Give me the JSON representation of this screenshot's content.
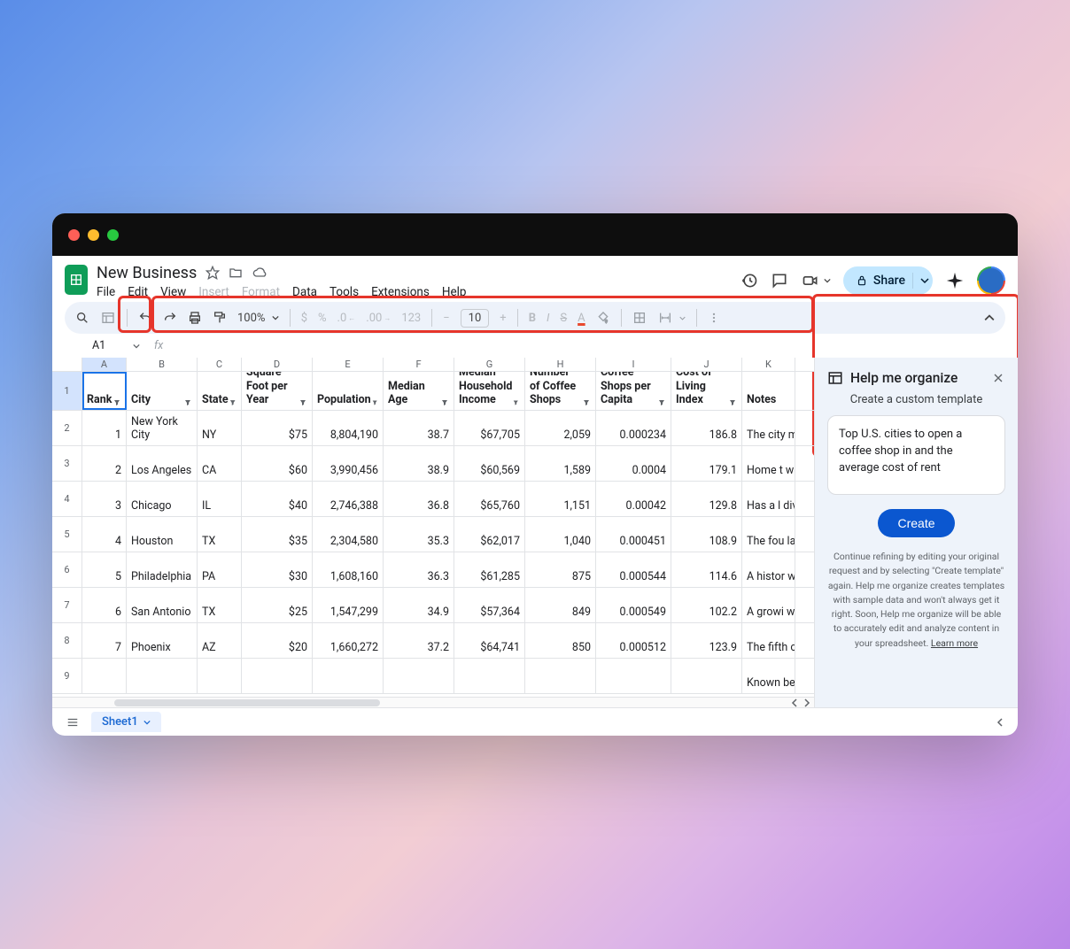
{
  "doc": {
    "title": "New Business"
  },
  "menu": {
    "file": "File",
    "edit": "Edit",
    "view": "View",
    "insert": "Insert",
    "format": "Format",
    "data": "Data",
    "tools": "Tools",
    "extensions": "Extensions",
    "help": "Help"
  },
  "toolbar": {
    "zoom": "100%",
    "font_size": "10",
    "format_num": "123"
  },
  "share": {
    "label": "Share"
  },
  "namebox": {
    "value": "A1"
  },
  "columns": {
    "widths": [
      50,
      80,
      50,
      80,
      80,
      80,
      80,
      80,
      85,
      80,
      60
    ],
    "letters": [
      "A",
      "B",
      "C",
      "D",
      "E",
      "F",
      "G",
      "H",
      "I",
      "J",
      "K"
    ]
  },
  "headers": [
    "Rank",
    "City",
    "State",
    "Average Rent per Square Foot per Year",
    "Population",
    "Median Age",
    "Median Household Income",
    "Number of Coffee Shops",
    "Coffee Shops per Capita",
    "Cost of Living Index",
    "Notes"
  ],
  "rows": [
    {
      "rank": "1",
      "city": "New York City",
      "state": "NY",
      "rent": "$75",
      "pop": "8,804,190",
      "age": "38.7",
      "income": "$67,705",
      "shops": "2,059",
      "per": "0.000234",
      "cli": "186.8",
      "notes": "The city most co shops i U.S."
    },
    {
      "rank": "2",
      "city": "Los Angeles",
      "state": "CA",
      "rent": "$60",
      "pop": "3,990,456",
      "age": "38.9",
      "income": "$60,569",
      "shops": "1,589",
      "per": "0.0004",
      "cli": "179.1",
      "notes": "Home t well-kn coffee c"
    },
    {
      "rank": "3",
      "city": "Chicago",
      "state": "IL",
      "rent": "$40",
      "pop": "2,746,388",
      "age": "36.8",
      "income": "$65,760",
      "shops": "1,151",
      "per": "0.00042",
      "cli": "129.8",
      "notes": "Has a l divers populat"
    },
    {
      "rank": "4",
      "city": "Houston",
      "state": "TX",
      "rent": "$35",
      "pop": "2,304,580",
      "age": "35.3",
      "income": "$62,017",
      "shops": "1,040",
      "per": "0.000451",
      "cli": "108.9",
      "notes": "The fou largest the U.S"
    },
    {
      "rank": "5",
      "city": "Philadelphia",
      "state": "PA",
      "rent": "$30",
      "pop": "1,608,160",
      "age": "36.3",
      "income": "$61,285",
      "shops": "875",
      "per": "0.000544",
      "cli": "114.6",
      "notes": "A histor with a s coffee c"
    },
    {
      "rank": "6",
      "city": "San Antonio",
      "state": "TX",
      "rent": "$25",
      "pop": "1,547,299",
      "age": "34.9",
      "income": "$57,364",
      "shops": "849",
      "per": "0.000549",
      "cli": "102.2",
      "notes": "A growi with a d populat"
    },
    {
      "rank": "7",
      "city": "Phoenix",
      "state": "AZ",
      "rent": "$20",
      "pop": "1,660,272",
      "age": "37.2",
      "income": "$64,741",
      "shops": "850",
      "per": "0.000512",
      "cli": "123.9",
      "notes": "The fifth city in th"
    },
    {
      "rank": "",
      "city": "",
      "state": "",
      "rent": "",
      "pop": "",
      "age": "",
      "income": "",
      "shops": "",
      "per": "",
      "cli": "",
      "notes": "Known beautifu weather"
    }
  ],
  "sidepanel": {
    "title": "Help me organize",
    "subtitle": "Create a custom template",
    "prompt": "Top U.S. cities to open a coffee shop in and the average cost of rent",
    "create": "Create",
    "footer": "Continue refining by editing your original request and by selecting \"Create template\" again. Help me organize creates templates with sample data and won't always get it right. Soon, Help me organize will be able to accurately edit and analyze content in your spreadsheet. ",
    "learn": "Learn more"
  },
  "tabs": {
    "sheet1": "Sheet1"
  }
}
